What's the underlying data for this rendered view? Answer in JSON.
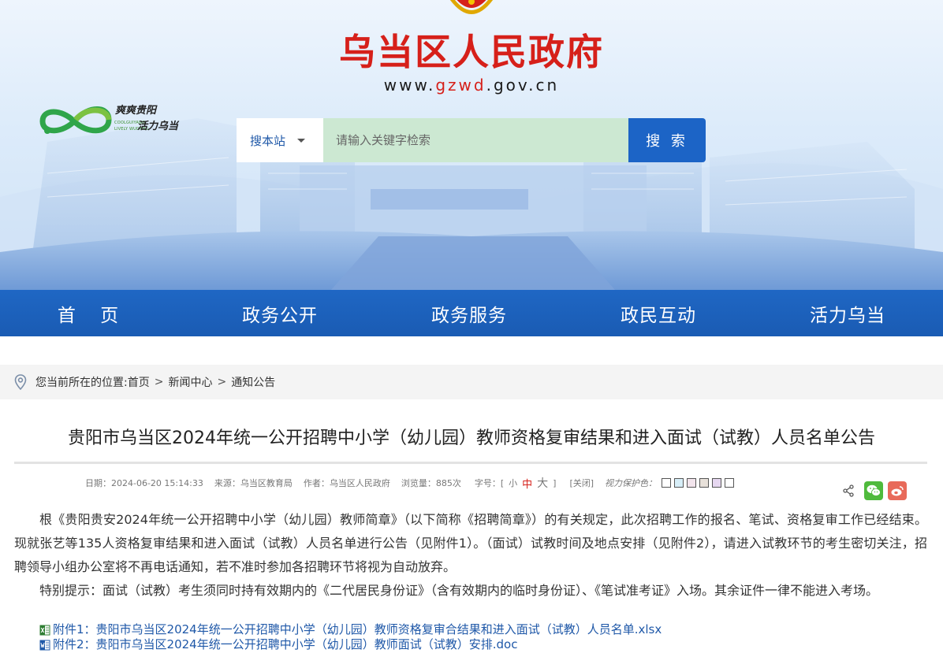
{
  "banner": {
    "title": "乌当区人民政府",
    "url_prefix": "www.",
    "url_highlight": "gzwd",
    "url_suffix": ".gov.cn",
    "brand_line1": "爽爽贵阳",
    "brand_line2": "活力乌当",
    "brand_small1": "COOLGUIYANG",
    "brand_small2": "LIVELY WUDANG"
  },
  "search": {
    "scope_label": "搜本站",
    "placeholder": "请输入关键字检索",
    "button_label": "搜 索"
  },
  "nav": {
    "items": [
      {
        "label": "首 页"
      },
      {
        "label": "政务公开"
      },
      {
        "label": "政务服务"
      },
      {
        "label": "政民互动"
      },
      {
        "label": "活力乌当"
      }
    ]
  },
  "breadcrumb": {
    "prefix": "您当前所在的位置:",
    "items": [
      "首页",
      "新闻中心",
      "通知公告"
    ],
    "separator": ">"
  },
  "article": {
    "title": "贵阳市乌当区2024年统一公开招聘中小学（幼儿园）教师资格复审结果和进入面试（试教）人员名单公告",
    "meta": {
      "date": "日期：2024-06-20 15:14:33",
      "source": "来源：乌当区教育局",
      "author": "作者：乌当区人民政府",
      "views": "浏览量：885次",
      "font_size_label": "字号：[",
      "font_small": "小",
      "font_mid": "中",
      "font_big": "大",
      "font_end": "]",
      "close": "[关闭]",
      "vision_label": "视力保护色："
    },
    "swatch_colors": [
      "#ffffff",
      "#d7eef8",
      "#f2e4ec",
      "#e8e1da",
      "#e6d7f0",
      "#ffffff"
    ],
    "paragraphs": [
      "根《贵阳贵安2024年统一公开招聘中小学（幼儿园）教师简章》（以下简称《招聘简章》）的有关规定，此次招聘工作的报名、笔试、资格复审工作已经结束。现就张艺等135人资格复审结果和进入面试（试教）人员名单进行公告（见附件1）。（面试）试教时间及地点安排（见附件2），请进入试教环节的考生密切关注，招聘领导小组办公室将不再电话通知，若不准时参加各招聘环节将视为自动放弃。",
      "特别提示：面试（试教）考生须同时持有效期内的《二代居民身份证》（含有效期内的临时身份证）、《笔试准考证》入场。其余证件一律不能进入考场。"
    ],
    "attachments": [
      {
        "label": "附件1：贵阳市乌当区2024年统一公开招聘中小学（幼儿园）教师资格复审合结果和进入面试（试教）人员名单.xlsx",
        "icon": "excel-file-icon"
      },
      {
        "label": "附件2：贵阳市乌当区2024年统一公开招聘中小学（幼儿园）教师面试（试教）安排.doc",
        "icon": "word-file-icon"
      }
    ]
  },
  "colors": {
    "brand_red": "#d6201a",
    "nav_blue": "#1c64c6",
    "link_blue": "#1f58a8",
    "search_green": "#cce8d2"
  }
}
